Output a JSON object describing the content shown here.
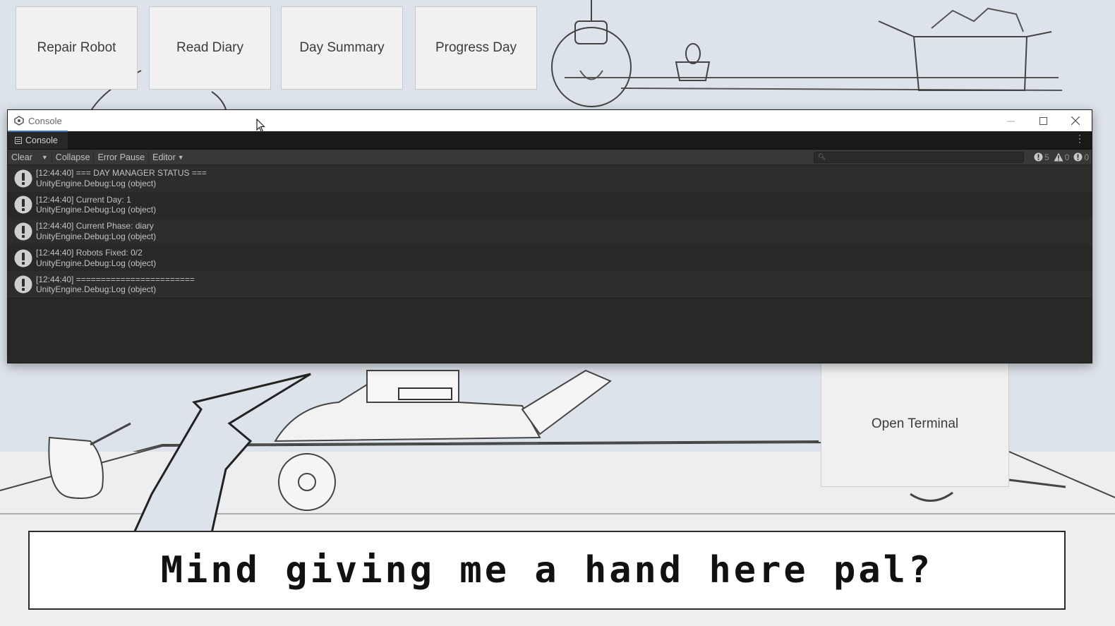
{
  "game_buttons": {
    "repair_robot": "Repair Robot",
    "read_diary": "Read Diary",
    "day_summary": "Day Summary",
    "progress_day": "Progress Day",
    "open_terminal": "Open Terminal"
  },
  "dialogue": {
    "text": "Mind giving me a hand here pal?"
  },
  "console": {
    "window_title": "Console",
    "tab_label": "Console",
    "toolbar": {
      "clear": "Clear",
      "collapse": "Collapse",
      "error_pause": "Error Pause",
      "editor": "Editor"
    },
    "counts": {
      "logs": "5",
      "warnings": "0",
      "errors": "0"
    },
    "entries": [
      {
        "line1": "[12:44:40] === DAY MANAGER STATUS ===",
        "line2": "UnityEngine.Debug:Log (object)"
      },
      {
        "line1": "[12:44:40] Current Day: 1",
        "line2": "UnityEngine.Debug:Log (object)"
      },
      {
        "line1": "[12:44:40] Current Phase: diary",
        "line2": "UnityEngine.Debug:Log (object)"
      },
      {
        "line1": "[12:44:40] Robots Fixed: 0/2",
        "line2": "UnityEngine.Debug:Log (object)"
      },
      {
        "line1": "[12:44:40] ========================",
        "line2": "UnityEngine.Debug:Log (object)"
      }
    ]
  },
  "colors": {
    "console_bg": "#282828",
    "tab_accent": "#3a79bb",
    "scene_bg": "#dde3ea"
  }
}
